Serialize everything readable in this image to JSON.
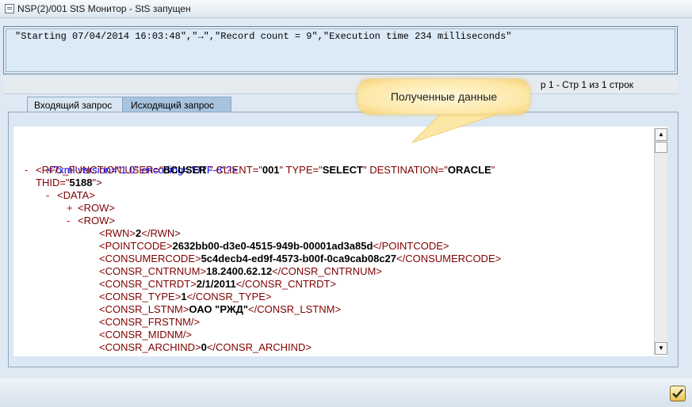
{
  "window": {
    "title": "NSP(2)/001 StS Монитор - StS запущен"
  },
  "message": {
    "text": "\"Starting 07/04/2014 16:03:48\",\"→\",\"Record count = 9\",\"Execution time 234 milliseconds\""
  },
  "status": {
    "text": "р 1 - Стр 1 из 1 строк"
  },
  "tooltip": {
    "text": "Полученные данные"
  },
  "tabs": [
    {
      "label": "Входящий запрос"
    },
    {
      "label": "Исходящий запрос"
    }
  ],
  "xml": {
    "decl": "<?xml version=\"1.0\" encoding=\"UTF-8\"?>",
    "rfc_open": "<RFC_FUNCTION",
    "attr_user": "USER=\"",
    "user": "BCUSER ",
    "attr_client": "\" CLIENT=\"",
    "client": "001",
    "attr_type": "\" TYPE=\"",
    "type": "SELECT",
    "attr_dest": "\" DESTINATION=\"",
    "dest": "ORACLE",
    "attr_thid": "THID=\"",
    "thid": "5188",
    "close_attr": "\">",
    "data_tag": "<DATA>",
    "row_tag": "<ROW>",
    "collapse": "-",
    "expand": "+",
    "fields": [
      {
        "open": "<RWN>",
        "value": "2",
        "close": "</RWN>"
      },
      {
        "open": "<POINTCODE>",
        "value": "2632bb00-d3e0-4515-949b-00001ad3a85d",
        "close": "</POINTCODE>"
      },
      {
        "open": "<CONSUMERCODE>",
        "value": "5c4decb4-ed9f-4573-b00f-0ca9cab08c27",
        "close": "</CONSUMERCODE>"
      },
      {
        "open": "<CONSR_CNTRNUM>",
        "value": "18.2400.62.12",
        "close": "</CONSR_CNTRNUM>"
      },
      {
        "open": "<CONSR_CNTRDT>",
        "value": "2/1/2011",
        "close": "</CONSR_CNTRDT>"
      },
      {
        "open": "<CONSR_TYPE>",
        "value": "1",
        "close": "</CONSR_TYPE>"
      },
      {
        "open": "<CONSR_LSTNM>",
        "value": "ОАО \"РЖД\"",
        "close": "</CONSR_LSTNM>"
      },
      {
        "open": "<CONSR_FRSTNM/>",
        "value": "",
        "close": ""
      },
      {
        "open": "<CONSR_MIDNM/>",
        "value": "",
        "close": ""
      },
      {
        "open": "<CONSR_ARCHIND>",
        "value": "0",
        "close": "</CONSR_ARCHIND>"
      }
    ]
  },
  "icons": {
    "title": "window-icon",
    "ok": "checkmark-icon",
    "scroll_up": "scroll-up-arrow-icon",
    "scroll_down": "scroll-down-arrow-icon"
  }
}
